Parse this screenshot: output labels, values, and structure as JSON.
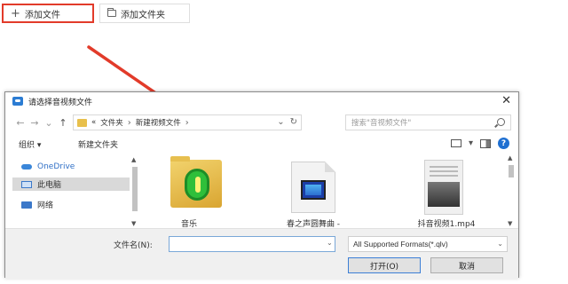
{
  "top": {
    "add_file_icon": "+",
    "add_file_label": "添加文件",
    "add_folder_label": "添加文件夹"
  },
  "dialog": {
    "title": "请选择音视频文件",
    "close": "✕",
    "nav": {
      "back": "←",
      "forward": "→",
      "down": "⌄",
      "up": "↑"
    },
    "address": {
      "prefix": "«",
      "segments": [
        "文件夹",
        "新建视频文件"
      ],
      "separator": "›"
    },
    "search_placeholder": "搜索\"音视频文件\"",
    "toolbar": {
      "organize": "组织 ▾",
      "new_folder": "新建文件夹"
    },
    "nav_pane": [
      {
        "label": "OneDrive",
        "icon": "cloud-icon"
      },
      {
        "label": "此电脑",
        "icon": "computer-icon"
      },
      {
        "label": "网络",
        "icon": "network-icon"
      }
    ],
    "files": [
      {
        "name": "音乐",
        "icon": "music-folder-icon"
      },
      {
        "name": "春之声圆舞曲 -",
        "icon": "video-file-icon"
      },
      {
        "name": "抖音视频1.mp4",
        "icon": "video-thumbnail-icon"
      }
    ],
    "filename_label": "文件名(N):",
    "filename_value": "",
    "filetype_selected": "All Supported Formats(*.qlv)",
    "open_button": "打开(O)",
    "cancel_button": "取消"
  },
  "colors": {
    "highlight_border": "#e23b2a",
    "annotation_arrow": "#e23b2a",
    "accent": "#2b7cd3"
  }
}
